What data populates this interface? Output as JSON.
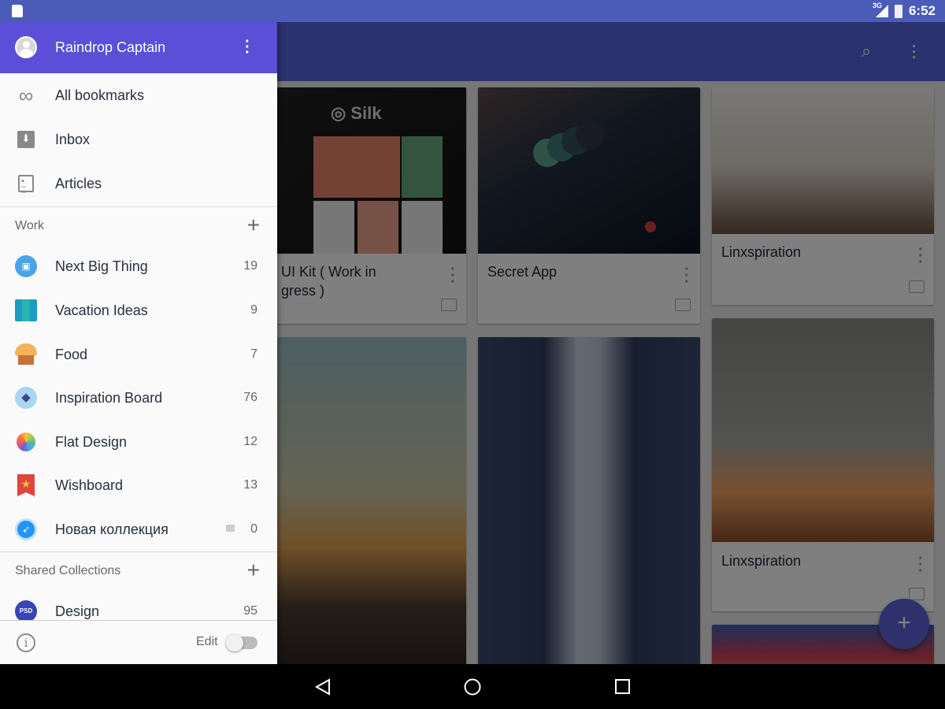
{
  "status_bar": {
    "network": "3G",
    "time": "6:52",
    "icons": [
      "sd-card-icon",
      "signal-icon",
      "battery-charging-icon"
    ]
  },
  "drawer": {
    "user_name": "Raindrop Captain",
    "main_items": [
      {
        "label": "All bookmarks",
        "icon": "infinity-icon"
      },
      {
        "label": "Inbox",
        "icon": "inbox-icon"
      },
      {
        "label": "Articles",
        "icon": "article-icon"
      }
    ],
    "work_section": {
      "title": "Work",
      "items": [
        {
          "label": "Next Big Thing",
          "count": "19",
          "icon": "chat-bubble-icon",
          "color": "#4aa3e6"
        },
        {
          "label": "Vacation Ideas",
          "count": "9",
          "icon": "map-icon",
          "color": "#2bb5b0"
        },
        {
          "label": "Food",
          "count": "7",
          "icon": "muffin-icon",
          "color": "#f3b35a"
        },
        {
          "label": "Inspiration Board",
          "count": "76",
          "icon": "diamond-icon",
          "color": "#a9d6f3"
        },
        {
          "label": "Flat Design",
          "count": "12",
          "icon": "photos-flower-icon",
          "color": "#e85a7a"
        },
        {
          "label": "Wishboard",
          "count": "13",
          "icon": "star-bookmark-icon",
          "color": "#e0453e"
        },
        {
          "label": "Новая коллекция",
          "count": "0",
          "icon": "compass-icon",
          "color": "#2196f3",
          "locked": true
        }
      ]
    },
    "shared_section": {
      "title": "Shared Collections",
      "items": [
        {
          "label": "Design",
          "count": "95",
          "icon": "psd-icon",
          "icon_text": "PSD",
          "color": "#3a43b8"
        }
      ]
    },
    "footer": {
      "edit_label": "Edit",
      "edit_on": false
    }
  },
  "cards": [
    {
      "title": "UI Kit ( Work in\ngress )"
    },
    {
      "title": "Secret App"
    },
    {
      "title": "Linxspiration"
    },
    {
      "title": "Linxspiration"
    }
  ],
  "colors": {
    "accent": "#5a4fd6",
    "appbar": "#5566dd",
    "fab": "#5d63d8"
  }
}
